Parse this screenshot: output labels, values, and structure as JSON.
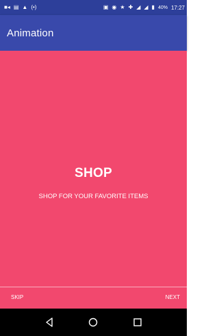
{
  "status_bar": {
    "left_icons": [
      "video-call-icon",
      "message-icon",
      "alert-icon",
      "broadcast-icon"
    ],
    "right_icons": [
      "screen-cast-icon",
      "gamepad-icon",
      "star-icon",
      "data-saver-icon",
      "signal-icon",
      "signal-icon"
    ],
    "battery_percent": "40%",
    "time": "17:27"
  },
  "app_bar": {
    "title": "Animation",
    "color": "#3949ab"
  },
  "content": {
    "background": "#f2486e",
    "heading": "SHOP",
    "subheading": "SHOP FOR YOUR FAVORITE ITEMS"
  },
  "footer": {
    "skip_label": "SKIP",
    "next_label": "NEXT"
  },
  "nav_bar": {
    "buttons": [
      "back-icon",
      "home-icon",
      "recents-icon"
    ]
  }
}
